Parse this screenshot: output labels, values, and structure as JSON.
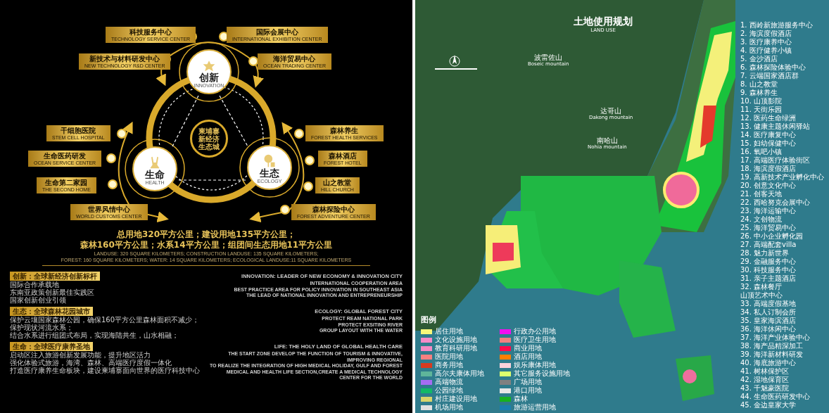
{
  "diagram": {
    "hub": [
      "柬埔寨",
      "新经济",
      "生态城"
    ],
    "pillars": [
      {
        "kind": "innovation",
        "zh": "创新",
        "en": "INNOVATION"
      },
      {
        "kind": "health",
        "zh": "生命",
        "en": "HEALTH"
      },
      {
        "kind": "ecology",
        "zh": "生态",
        "en": "ECOLOGY"
      }
    ],
    "labels": [
      {
        "zh": "科技服务中心",
        "en": "TECHNOLOGY SERVICE CENTER"
      },
      {
        "zh": "国际会展中心",
        "en": "INTERNATIONAL EXHIBITION CENTER"
      },
      {
        "zh": "新技术与材料研发中心",
        "en": "NEW TECHNOLOGY R&D CENTER"
      },
      {
        "zh": "海洋贸易中心",
        "en": "OCEAN TRADING CENTER"
      },
      {
        "zh": "干细胞医院",
        "en": "STEM CELL HOSPITAL"
      },
      {
        "zh": "生命医药研发",
        "en": "OCEAN SERVICE CENTER"
      },
      {
        "zh": "生命第二家园",
        "en": "THE SECOND HOME"
      },
      {
        "zh": "世界风情中心",
        "en": "WORLD CUSTOMS CENTER"
      },
      {
        "zh": "森林养生",
        "en": "FOREST HEALTH SERVICES"
      },
      {
        "zh": "森林酒店",
        "en": "FOREST HOTEL"
      },
      {
        "zh": "山之教堂",
        "en": "HILL CHURCH"
      },
      {
        "zh": "森林探险中心",
        "en": "FOREST ADVENTURE CENTER"
      }
    ]
  },
  "summary": {
    "zh": [
      "总用地320平方公里；建设用地135平方公里；",
      "森林160平方公里；水系14平方公里；组团间生态用地11平方公里"
    ],
    "en": [
      "LANDUSE: 320 SQUARE KILOMETERS; CONSTRUCTION LANDUSE: 135 SQUARE KILOMETERS;",
      "FOREST: 160 SQUARE KILOMETERS; WATER: 14 SQUARE KILOMETERS; ECOLOGICAL LANDUSE:11 SQUARE KILOMETERS"
    ]
  },
  "themes": [
    {
      "heading": "创新：全球新经济创新标杆",
      "lines": [
        "国际合作承载地",
        "东南亚政策创新最佳实践区",
        "国家创新创业引领"
      ],
      "heading_en": "INNOVATION:   LEADER OF NEW ECONOMY & INNOVATION CITY",
      "lines_en": [
        "INTERNATIONAL COOPERATION AREA",
        "BEST PRACTICE AREA FOR POLICY INNOVATION IN SOUTHEAST ASIA",
        "THE LEAD OF NATIONAL INNOVATION AND ENTREPRENEURSHIP"
      ]
    },
    {
      "heading": "生态：全球森林花园城市",
      "lines": [
        "保护云壤国家森林公园，确保160平方公里森林面积不减少；",
        "保护现状河流水系；",
        "结合水系进行组团式布局，实现海陆共生，山水相融；"
      ],
      "heading_en": "ECOLOGY:  GLOBAL FOREST CITY",
      "lines_en": [
        "PROTECT REAM NATIONAL PARK",
        "PROTECT EXSITING RIVER",
        "GROUP LAYOUT WITH THE WATER"
      ]
    },
    {
      "heading": "生命：全球医疗康养圣地",
      "lines": [
        "启动区注入旅游创新发展功能，提升地区活力",
        "强化体验式旅游，海湾、森林、高端医疗度假一体化",
        "打造医疗康养生命板块，建设柬埔寨面向世界的医疗科技中心"
      ],
      "heading_en": "LIFE: THE HOLY LAND OF GLOBAL HEALTH CARE",
      "lines_en": [
        "THE START ZONE DEVELOP THE FUNCTION OF TOURISM & INNOVATIVE, IMPROVING REGIONAL",
        "TO REALIZE THE  INTEGRATION OF HIGH MEDICAL HOLIDAY, GULF AND FOREST",
        "MEDICAL AND HEALTH LIFE SECTION,CREATE A   MEDICAL TECHNOLOGY CENTER FOR THE WORLD"
      ]
    }
  ],
  "map": {
    "title": "土地使用规划",
    "subtitle": "LAND USE",
    "places": [
      {
        "zh": "波雷佐山",
        "en": "Boseic mountain"
      },
      {
        "zh": "达哥山",
        "en": "Dakong mountain"
      },
      {
        "zh": "南哈山",
        "en": "Nohia mountain"
      }
    ],
    "legend": {
      "title": "图例",
      "items": [
        {
          "label": "居住用地",
          "color": "#f7f77a"
        },
        {
          "label": "行政办公用地",
          "color": "#f20ef0"
        },
        {
          "label": "文化设施用地",
          "color": "#f58ac8"
        },
        {
          "label": "医疗卫生用地",
          "color": "#f28080"
        },
        {
          "label": "教育科研用地",
          "color": "#f48bc4"
        },
        {
          "label": "商业用地",
          "color": "#ff0a4c"
        },
        {
          "label": "医院用地",
          "color": "#f78080"
        },
        {
          "label": "酒店用地",
          "color": "#ff7f00"
        },
        {
          "label": "商务用地",
          "color": "#d63a1f"
        },
        {
          "label": "娱乐康体用地",
          "color": "#fcd2dc"
        },
        {
          "label": "高尔夫康体用地",
          "color": "#5fb59a"
        },
        {
          "label": "其它服务设施用地",
          "color": "#dcff6e"
        },
        {
          "label": "高端物流",
          "color": "#a56cf2"
        },
        {
          "label": "广场用地",
          "color": "#808080"
        },
        {
          "label": "公园绿地",
          "color": "#12b866"
        },
        {
          "label": "港口用地",
          "color": "#e6e6e6"
        },
        {
          "label": "村庄建设用地",
          "color": "#d8d46a"
        },
        {
          "label": "森林",
          "color": "#16b020"
        },
        {
          "label": "机场用地",
          "color": "#e0e0e0"
        },
        {
          "label": "旅游运营用地",
          "color": "#1a7fb0"
        }
      ]
    },
    "projects": [
      {
        "text": "1. 西岭新旅游服务中心"
      },
      {
        "text": "2. 海滨度假酒店"
      },
      {
        "text": "3. 医疗康养中心"
      },
      {
        "text": "4. 医疗健养小镇"
      },
      {
        "text": "5. 金沙酒店"
      },
      {
        "text": "6. 森林探险体验中心"
      },
      {
        "text": "7. 云端国家酒店群"
      },
      {
        "text": "8. 山之教堂"
      },
      {
        "text": "9. 森林养生"
      },
      {
        "text": "10. 山顶影院"
      },
      {
        "text": "11. 天街乐园"
      },
      {
        "text": "12. 医药生命绿洲"
      },
      {
        "text": "13. 健康主题休闲驿站"
      },
      {
        "text": "14. 医疗康复中心"
      },
      {
        "text": "15. 妇幼保健中心"
      },
      {
        "text": "16. 氧吧小镇"
      },
      {
        "text": "17. 高端医疗体验街区"
      },
      {
        "text": "18. 海滨度假酒店"
      },
      {
        "text": "19. 高新技术产业孵化中心"
      },
      {
        "text": "20. 创意文化中心"
      },
      {
        "text": "21. 创客天地"
      },
      {
        "text": "22. 西哈努克会展中心"
      },
      {
        "text": "23. 海洋运输中心"
      },
      {
        "text": "24. 文创物流"
      },
      {
        "text": "25. 海洋贸易中心"
      },
      {
        "text": "26. 中小企业孵化园"
      },
      {
        "text": "27. 高端配套villa"
      },
      {
        "text": "28. 魅力新世界"
      },
      {
        "text": "29. 金融服务中心"
      },
      {
        "text": "30. 科技服务中心"
      },
      {
        "text": "31. 亲子主题酒店"
      },
      {
        "text": "32. 森林餐厅"
      },
      {
        "text": "山顶艺术中心"
      },
      {
        "text": "33. 高端度假基地"
      },
      {
        "text": "34. 私人订制会所"
      },
      {
        "text": "35. 皇家海滨酒店"
      },
      {
        "text": "36. 海洋休闲中心"
      },
      {
        "text": "37. 海洋产业体验中心"
      },
      {
        "text": "38. 海产品精深加工"
      },
      {
        "text": "39. 海洋新材料研发"
      },
      {
        "text": "40. 海底旅游中心"
      },
      {
        "text": "41. 树林保护区"
      },
      {
        "text": "42. 湿地保育区"
      },
      {
        "text": "43. 千魅豪医院"
      },
      {
        "text": "44. 生命医药研发中心"
      },
      {
        "text": "45. 金边皇家大学"
      }
    ]
  }
}
